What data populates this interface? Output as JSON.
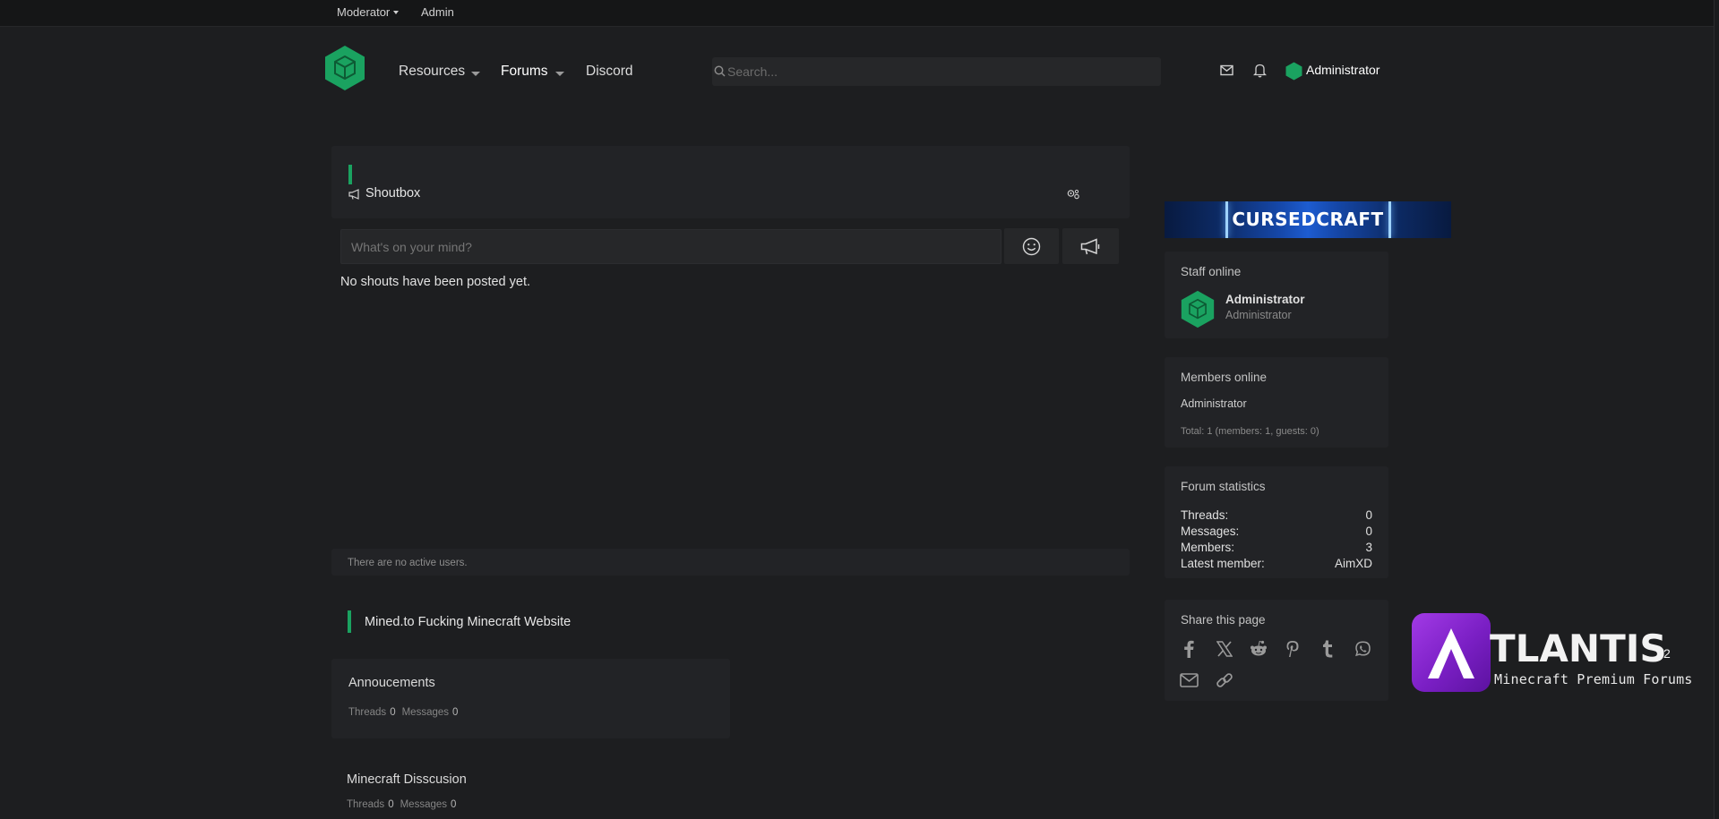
{
  "staffbar": {
    "moderator_label": "Moderator",
    "admin_label": "Admin"
  },
  "nav": {
    "resources_label": "Resources",
    "forums_label": "Forums",
    "discord_label": "Discord",
    "search_placeholder": "Search...",
    "user_name": "Administrator"
  },
  "shoutbox": {
    "title": "Shoutbox",
    "input_placeholder": "What's on your mind?",
    "empty_text": "No shouts have been posted yet.",
    "active_users_text": "There are no active users."
  },
  "category": {
    "title": "Mined.to Fucking Minecraft Website",
    "forums": [
      {
        "title": "Annoucements",
        "threads_label": "Threads",
        "threads": "0",
        "messages_label": "Messages",
        "messages": "0"
      },
      {
        "title": "Minecraft Disscusion",
        "threads_label": "Threads",
        "threads": "0",
        "messages_label": "Messages",
        "messages": "0"
      }
    ]
  },
  "sidebar": {
    "banner_text": "CURSEDCRAFT",
    "staff_online": {
      "title": "Staff online",
      "name": "Administrator",
      "role": "Administrator"
    },
    "members_online": {
      "title": "Members online",
      "member": "Administrator",
      "total": "Total: 1 (members: 1, guests: 0)"
    },
    "forum_stats": {
      "title": "Forum statistics",
      "threads_label": "Threads:",
      "threads": "0",
      "messages_label": "Messages:",
      "messages": "0",
      "members_label": "Members:",
      "members": "3",
      "latest_label": "Latest member:",
      "latest": "AimXD"
    },
    "share": {
      "title": "Share this page"
    }
  },
  "watermark": {
    "brand": "TLANTIS",
    "superscript": "2",
    "tagline": "Minecraft Premium Forums"
  },
  "colors": {
    "accent": "#1aa260",
    "background": "#1d1e20",
    "panel": "#222326",
    "logo_purple": "#8f2bd6"
  },
  "icons": [
    "logo-cube-icon",
    "search-icon",
    "mail-icon",
    "bell-icon",
    "megaphone-icon",
    "settings-icon",
    "smiley-icon",
    "facebook-icon",
    "x-icon",
    "reddit-icon",
    "pinterest-icon",
    "tumblr-icon",
    "whatsapp-icon",
    "email-icon",
    "link-icon"
  ]
}
